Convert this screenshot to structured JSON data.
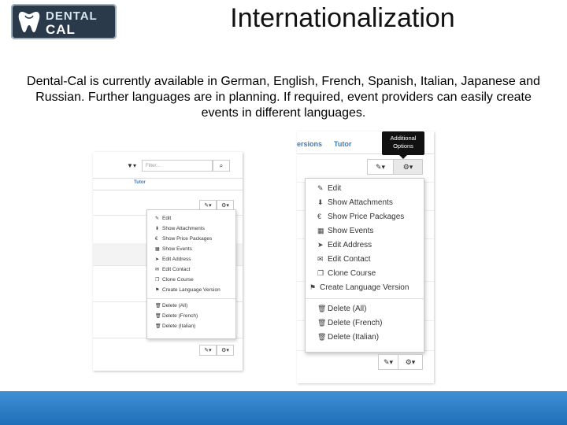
{
  "logo": {
    "line1": "DENTAL",
    "line2": "CAL"
  },
  "title": "Internationalization",
  "description": "Dental-Cal is currently available in German, English, French, Spanish, Italian, Japanese and Russian. Further languages are in planning. If required, event providers can easily create events in different languages.",
  "left_screenshot": {
    "filter_button": "▼▾",
    "filter_placeholder": "Filter...",
    "search_icon": "search-icon",
    "column_header": "Tutor",
    "edit_button": "✎▾",
    "options_button": "⚙▾",
    "menu_items": [
      {
        "icon": "edit-icon",
        "glyph": "✎",
        "label": "Edit"
      },
      {
        "icon": "download-icon",
        "glyph": "⬇",
        "label": "Show Attachments"
      },
      {
        "icon": "euro-icon",
        "glyph": "€",
        "label": "Show Price Packages"
      },
      {
        "icon": "calendar-icon",
        "glyph": "▦",
        "label": "Show Events"
      },
      {
        "icon": "location-arrow-icon",
        "glyph": "➤",
        "label": "Edit Address"
      },
      {
        "icon": "envelope-icon",
        "glyph": "✉",
        "label": "Edit Contact"
      },
      {
        "icon": "copy-icon",
        "glyph": "❐",
        "label": "Clone Course"
      },
      {
        "icon": "flag-icon",
        "glyph": "⚑",
        "label": "Create Language Version"
      }
    ],
    "delete_items": [
      {
        "icon": "trash-icon",
        "glyph": "🗑",
        "label": "Delete (All)"
      },
      {
        "icon": "trash-icon",
        "glyph": "🗑",
        "label": "Delete (French)"
      },
      {
        "icon": "trash-icon",
        "glyph": "🗑",
        "label": "Delete (Italian)"
      }
    ]
  },
  "right_screenshot": {
    "tab1": "ersions",
    "tab2": "Tutor",
    "tooltip_line1": "Additional",
    "tooltip_line2": "Options",
    "edit_button": "✎▾",
    "options_button": "⚙▾",
    "menu_items": [
      {
        "icon": "edit-icon",
        "glyph": "✎",
        "label": "Edit"
      },
      {
        "icon": "download-icon",
        "glyph": "⬇",
        "label": "Show Attachments"
      },
      {
        "icon": "euro-icon",
        "glyph": "€",
        "label": "Show Price Packages"
      },
      {
        "icon": "calendar-icon",
        "glyph": "▦",
        "label": "Show Events"
      },
      {
        "icon": "location-arrow-icon",
        "glyph": "➤",
        "label": "Edit Address"
      },
      {
        "icon": "envelope-icon",
        "glyph": "✉",
        "label": "Edit Contact"
      },
      {
        "icon": "copy-icon",
        "glyph": "❐",
        "label": "Clone Course"
      },
      {
        "icon": "flag-icon",
        "glyph": "⚑",
        "label": "Create Language Version"
      }
    ],
    "delete_items": [
      {
        "icon": "trash-icon",
        "glyph": "🗑",
        "label": "Delete (All)"
      },
      {
        "icon": "trash-icon",
        "glyph": "🗑",
        "label": "Delete (French)"
      },
      {
        "icon": "trash-icon",
        "glyph": "🗑",
        "label": "Delete (Italian)"
      }
    ]
  },
  "colors": {
    "footer": "#2a7dc9",
    "link": "#3a7bbf",
    "logo_bg": "#2b3a4a"
  }
}
